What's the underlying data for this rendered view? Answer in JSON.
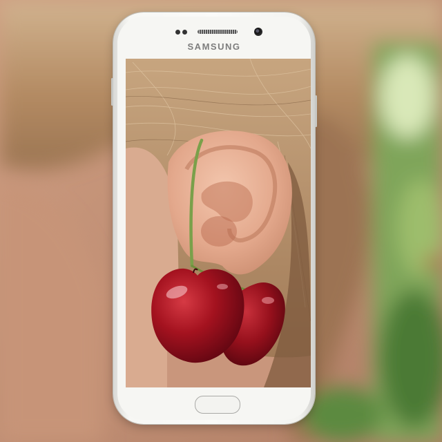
{
  "image": {
    "subject": "cherry-earring-on-ear",
    "device_brand": "SAMSUNG",
    "colors": {
      "hair": "#b8926c",
      "skin": "#d9a98e",
      "cherry": "#8e0f1a",
      "foliage": "#6f9a45",
      "phone_body": "#f6f6f3"
    }
  }
}
